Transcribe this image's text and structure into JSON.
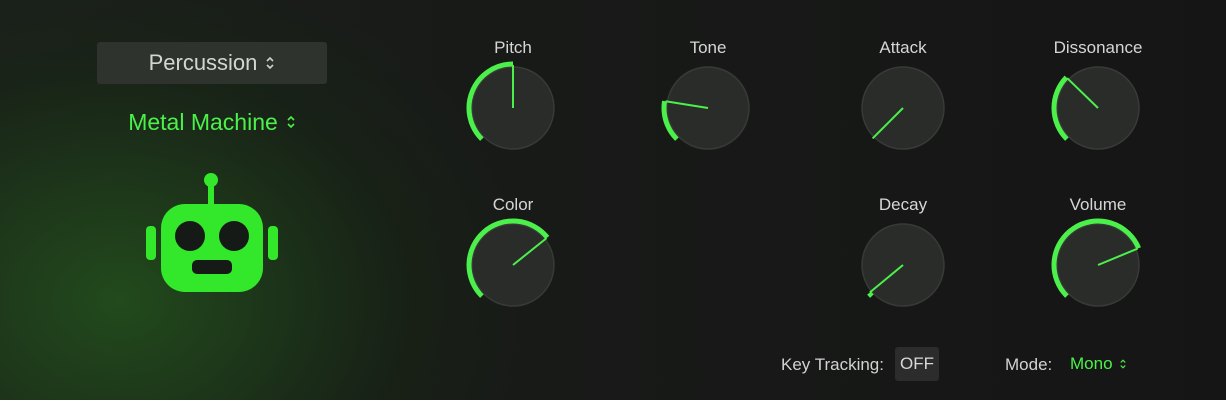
{
  "category": {
    "label": "Percussion"
  },
  "preset": {
    "label": "Metal Machine"
  },
  "accent_color": "#4cf04a",
  "robot_icon": "robot-icon",
  "knobs": [
    {
      "id": "pitch",
      "label": "Pitch",
      "value": 0.5
    },
    {
      "id": "tone",
      "label": "Tone",
      "value": 0.2
    },
    {
      "id": "attack",
      "label": "Attack",
      "value": 0.0
    },
    {
      "id": "dissonance",
      "label": "Dissonance",
      "value": 0.33
    },
    {
      "id": "color",
      "label": "Color",
      "value": 0.69
    },
    {
      "id": "decay",
      "label": "Decay",
      "value": 0.02
    },
    {
      "id": "volume",
      "label": "Volume",
      "value": 0.75
    }
  ],
  "footer": {
    "key_tracking_label": "Key Tracking:",
    "key_tracking_value": "OFF",
    "mode_label": "Mode:",
    "mode_value": "Mono"
  }
}
